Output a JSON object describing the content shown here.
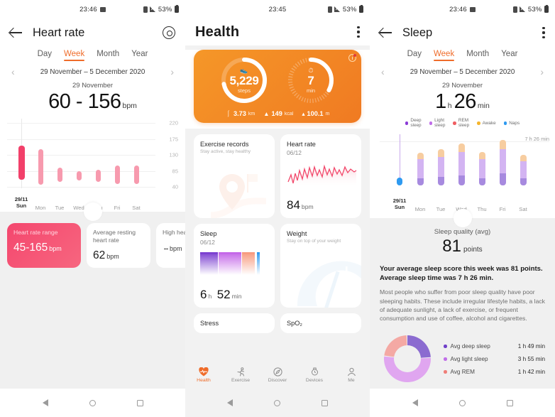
{
  "panel_heart_rate": {
    "statusbar": {
      "time": "23:46",
      "battery": "53%"
    },
    "title": "Heart rate",
    "tabs": [
      {
        "label": "Day",
        "active": false
      },
      {
        "label": "Week",
        "active": true
      },
      {
        "label": "Month",
        "active": false
      },
      {
        "label": "Year",
        "active": false
      }
    ],
    "date_range": "29 November – 5 December 2020",
    "selected_date": "29 November",
    "value": "60 - 156",
    "unit": "bpm",
    "chart_data": {
      "type": "bar",
      "title": "Heart rate range per day",
      "categories": [
        "29/11\nSun",
        "Mon",
        "Tue",
        "Wed",
        "Thu",
        "Fri",
        "Sat"
      ],
      "day_labels": [
        "29/11",
        "Mon",
        "Tue",
        "Wed",
        "Thu",
        "Fri",
        "Sat"
      ],
      "day_sublabels": [
        "Sun",
        "",
        "",
        "",
        "",
        "",
        ""
      ],
      "series": [
        {
          "name": "min_bpm",
          "values": [
            60,
            47,
            55,
            58,
            54,
            49,
            48
          ]
        },
        {
          "name": "max_bpm",
          "values": [
            156,
            146,
            95,
            84,
            89,
            101,
            101
          ]
        }
      ],
      "yticks": [
        220,
        175,
        130,
        85,
        40
      ],
      "ylim": [
        40,
        220
      ],
      "ylabel": "bpm",
      "grid": true,
      "selected_index": 0
    },
    "cards": [
      {
        "label": "Heart rate range",
        "value": "45-165",
        "unit": "bpm",
        "highlight": true
      },
      {
        "label": "Average resting heart rate",
        "value": "62",
        "unit": "bpm",
        "highlight": false
      },
      {
        "label": "High hea",
        "value": "--",
        "unit": "bpm",
        "highlight": false
      }
    ]
  },
  "panel_health": {
    "statusbar": {
      "time": "23:45",
      "battery": "53%"
    },
    "title": "Health",
    "hero": {
      "steps_value": "5,229",
      "steps_label": "steps",
      "steps_progress": 0.72,
      "minutes_value": "7",
      "minutes_label": "min",
      "minutes_progress": 0.33,
      "stats": [
        {
          "icon": "distance-icon",
          "value": "3.73",
          "unit": "km"
        },
        {
          "icon": "flame-icon",
          "value": "149",
          "unit": "kcal"
        },
        {
          "icon": "climb-icon",
          "value": "100.1",
          "unit": "m"
        }
      ]
    },
    "cards": [
      {
        "title": "Exercise records",
        "subtitle": "Stay active, stay healthy",
        "date": "",
        "value": "",
        "unit": ""
      },
      {
        "title": "Heart rate",
        "subtitle": "",
        "date": "06/12",
        "value": "84",
        "unit": "bpm"
      },
      {
        "title": "Sleep",
        "subtitle": "",
        "date": "06/12",
        "value": "6",
        "unit": "h",
        "value2": "52",
        "unit2": "min"
      },
      {
        "title": "Weight",
        "subtitle": "Stay on top of your weight",
        "date": "",
        "value": "",
        "unit": ""
      },
      {
        "title": "Stress",
        "subtitle": "",
        "date": "",
        "value": "",
        "unit": ""
      },
      {
        "title": "SpO₂",
        "subtitle": "",
        "date": "",
        "value": "",
        "unit": ""
      }
    ],
    "bottom_nav": [
      {
        "label": "Health",
        "icon": "heart-pulse-icon",
        "active": true
      },
      {
        "label": "Exercise",
        "icon": "runner-icon",
        "active": false
      },
      {
        "label": "Discover",
        "icon": "compass-icon",
        "active": false
      },
      {
        "label": "Devices",
        "icon": "watch-icon",
        "active": false
      },
      {
        "label": "Me",
        "icon": "person-icon",
        "active": false
      }
    ]
  },
  "panel_sleep": {
    "statusbar": {
      "time": "23:46",
      "battery": "53%"
    },
    "title": "Sleep",
    "tabs": [
      {
        "label": "Day",
        "active": false
      },
      {
        "label": "Week",
        "active": true
      },
      {
        "label": "Month",
        "active": false
      },
      {
        "label": "Year",
        "active": false
      }
    ],
    "date_range": "29 November – 5 December 2020",
    "selected_date": "29 November",
    "value_h": "1",
    "value_h_unit": "h",
    "value_m": "26",
    "value_m_unit": "min",
    "legend": [
      {
        "label1": "Deep",
        "label2": "sleep",
        "color": "#8b3bd6"
      },
      {
        "label1": "Light",
        "label2": "sleep",
        "color": "#c06ee8"
      },
      {
        "label1": "REM",
        "label2": "sleep",
        "color": "#ef5e62"
      },
      {
        "label1": "Awake",
        "label2": "",
        "color": "#f5b52e"
      },
      {
        "label1": "Naps",
        "label2": "",
        "color": "#2e9af0"
      }
    ],
    "chart_data": {
      "type": "bar",
      "title": "Weekly sleep stages",
      "stacked": true,
      "categories": [
        "29/11",
        "Mon",
        "Tue",
        "Wed",
        "Thu",
        "Fri",
        "Sat"
      ],
      "day_sublabels": [
        "Sun",
        "",
        "",
        "",
        "",
        "",
        ""
      ],
      "series": [
        {
          "name": "Deep sleep",
          "color": "#a78adf",
          "values": [
            0.0,
            1.3,
            1.5,
            1.8,
            1.3,
            2.1,
            1.2
          ]
        },
        {
          "name": "Light sleep",
          "color": "#d3b4f2",
          "values": [
            0.0,
            3.4,
            3.6,
            4.2,
            3.5,
            4.4,
            3.2
          ]
        },
        {
          "name": "REM sleep",
          "color": "#f7cda0",
          "values": [
            0.0,
            1.2,
            1.4,
            1.6,
            1.2,
            1.7,
            1.1
          ]
        },
        {
          "name": "Naps",
          "color": "#2e9af0",
          "values": [
            1.43,
            0,
            0,
            0,
            0,
            0,
            0
          ]
        }
      ],
      "average_line_label": "7 h 26 min",
      "ylabel": "hours",
      "selected_index": 0
    },
    "quality_label": "Sleep quality (avg)",
    "quality_value": "81",
    "quality_unit": "points",
    "summary": "Your average sleep score this week was 81 points. Average sleep time was 7 h 26 min.",
    "advice": "Most people who suffer from poor sleep quality have poor sleeping habits. These include irregular lifestyle habits, a lack of adequate sunlight, a lack of exercise, or frequent consumption and use of coffee, alcohol and cigarettes.",
    "donut_chart": {
      "type": "pie",
      "title": "Average sleep breakdown",
      "labels": [
        "Avg deep sleep",
        "Avg light sleep",
        "Avg REM"
      ],
      "values": [
        1.82,
        3.92,
        1.7
      ],
      "display_values": [
        "1 h 49 min",
        "3 h 55 min",
        "1 h 42 min"
      ],
      "colors": [
        "#8b6bd0",
        "#e0a6f0",
        "#f4a9a4"
      ],
      "dot_colors": [
        "#6f3fc9",
        "#c06ee8",
        "#ef7e78"
      ]
    }
  },
  "colors": {
    "accent_orange": "#ef6c2a",
    "hr_pink": "#f79aae",
    "hr_pink_selected": "#f2406a",
    "sheet_grey": "#f0f0f0"
  }
}
